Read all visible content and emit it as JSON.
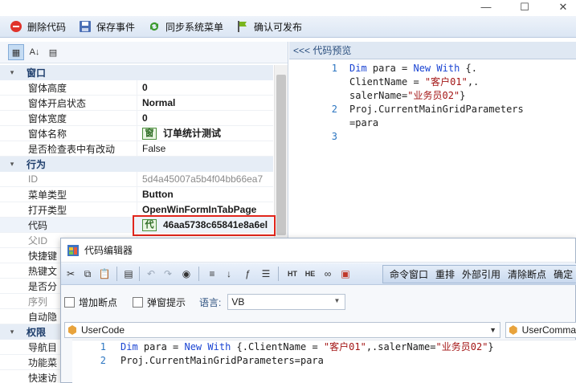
{
  "window": {
    "min_icon": "minimize-icon",
    "max_icon": "maximize-icon",
    "close_icon": "close-icon"
  },
  "toolbar": {
    "delete_code": "删除代码",
    "save_event": "保存事件",
    "sync_menu": "同步系统菜单",
    "confirm_publish": "确认可发布"
  },
  "property_grid": {
    "tools": [
      "categorized-icon",
      "alphabetical-icon",
      "property-pages-icon"
    ],
    "categories": {
      "window": "窗口",
      "behavior": "行为",
      "permission": "权限"
    },
    "window_rows": [
      {
        "key": "窗体高度",
        "value": "0"
      },
      {
        "key": "窗体开启状态",
        "value": "Normal"
      },
      {
        "key": "窗体宽度",
        "value": "0"
      },
      {
        "key": "窗体名称",
        "value": "订单统计测试",
        "badge": "窗"
      },
      {
        "key": "是否检查表中有改动",
        "value": "False"
      }
    ],
    "behavior_rows": [
      {
        "key": "ID",
        "value": "5d4a45007a5b4f04bb66ea7"
      },
      {
        "key": "菜单类型",
        "value": "Button"
      },
      {
        "key": "打开类型",
        "value": "OpenWinFormInTabPage"
      },
      {
        "key": "代码",
        "value": "46aa5738c65841e8a6el",
        "badge": "代"
      },
      {
        "key": "父ID",
        "value": ""
      },
      {
        "key": "快捷键",
        "value": ""
      },
      {
        "key": "热键文",
        "value": ""
      },
      {
        "key": "是否分",
        "value": ""
      },
      {
        "key": "序列",
        "value": ""
      },
      {
        "key": "自动隐",
        "value": ""
      }
    ],
    "permission_rows": [
      {
        "key": "导航目",
        "value": ""
      },
      {
        "key": "功能菜",
        "value": ""
      },
      {
        "key": "快速访",
        "value": ""
      }
    ]
  },
  "preview": {
    "header": "<<< 代码预览",
    "lines": [
      {
        "num": "1",
        "segments": [
          [
            "kw",
            "Dim"
          ],
          [
            "tx",
            " para = "
          ],
          [
            "kw",
            "New"
          ],
          [
            "tx",
            " "
          ],
          [
            "kw",
            "With"
          ],
          [
            "tx",
            " {."
          ]
        ]
      },
      {
        "num": "",
        "segments": [
          [
            "tx",
            "ClientName = "
          ],
          [
            "str",
            "\"客户01\""
          ],
          [
            "tx",
            ",."
          ]
        ]
      },
      {
        "num": "",
        "segments": [
          [
            "tx",
            "salerName="
          ],
          [
            "str",
            "\"业务员02\""
          ],
          [
            "tx",
            "}"
          ]
        ]
      },
      {
        "num": "2",
        "segments": [
          [
            "tx",
            "Proj.CurrentMainGridParameters"
          ]
        ]
      },
      {
        "num": "",
        "segments": [
          [
            "tx",
            "=para"
          ]
        ]
      },
      {
        "num": "3",
        "segments": [
          [
            "tx",
            ""
          ]
        ]
      }
    ]
  },
  "editor_dialog": {
    "title": "代码编辑器",
    "toolbar_group": [
      "命令窗口",
      "重排",
      "外部引用",
      "清除断点",
      "确定"
    ],
    "add_breakpoint": "增加断点",
    "popup_hint": "弹窗提示",
    "language_label": "语言:",
    "language_value": "VB",
    "class_combo": "UserCode",
    "member_combo": "UserComma",
    "lines": [
      {
        "num": "1",
        "segments": [
          [
            "kw",
            "Dim"
          ],
          [
            "tx",
            " para = "
          ],
          [
            "kw",
            "New"
          ],
          [
            "tx",
            " "
          ],
          [
            "kw",
            "With"
          ],
          [
            "tx",
            " {.ClientName = "
          ],
          [
            "str",
            "\"客户01\""
          ],
          [
            "tx",
            ",.salerName="
          ],
          [
            "str",
            "\"业务员02\""
          ],
          [
            "tx",
            "}"
          ]
        ]
      },
      {
        "num": "2",
        "segments": [
          [
            "tx",
            "Proj.CurrentMainGridParameters=para"
          ]
        ]
      }
    ]
  }
}
